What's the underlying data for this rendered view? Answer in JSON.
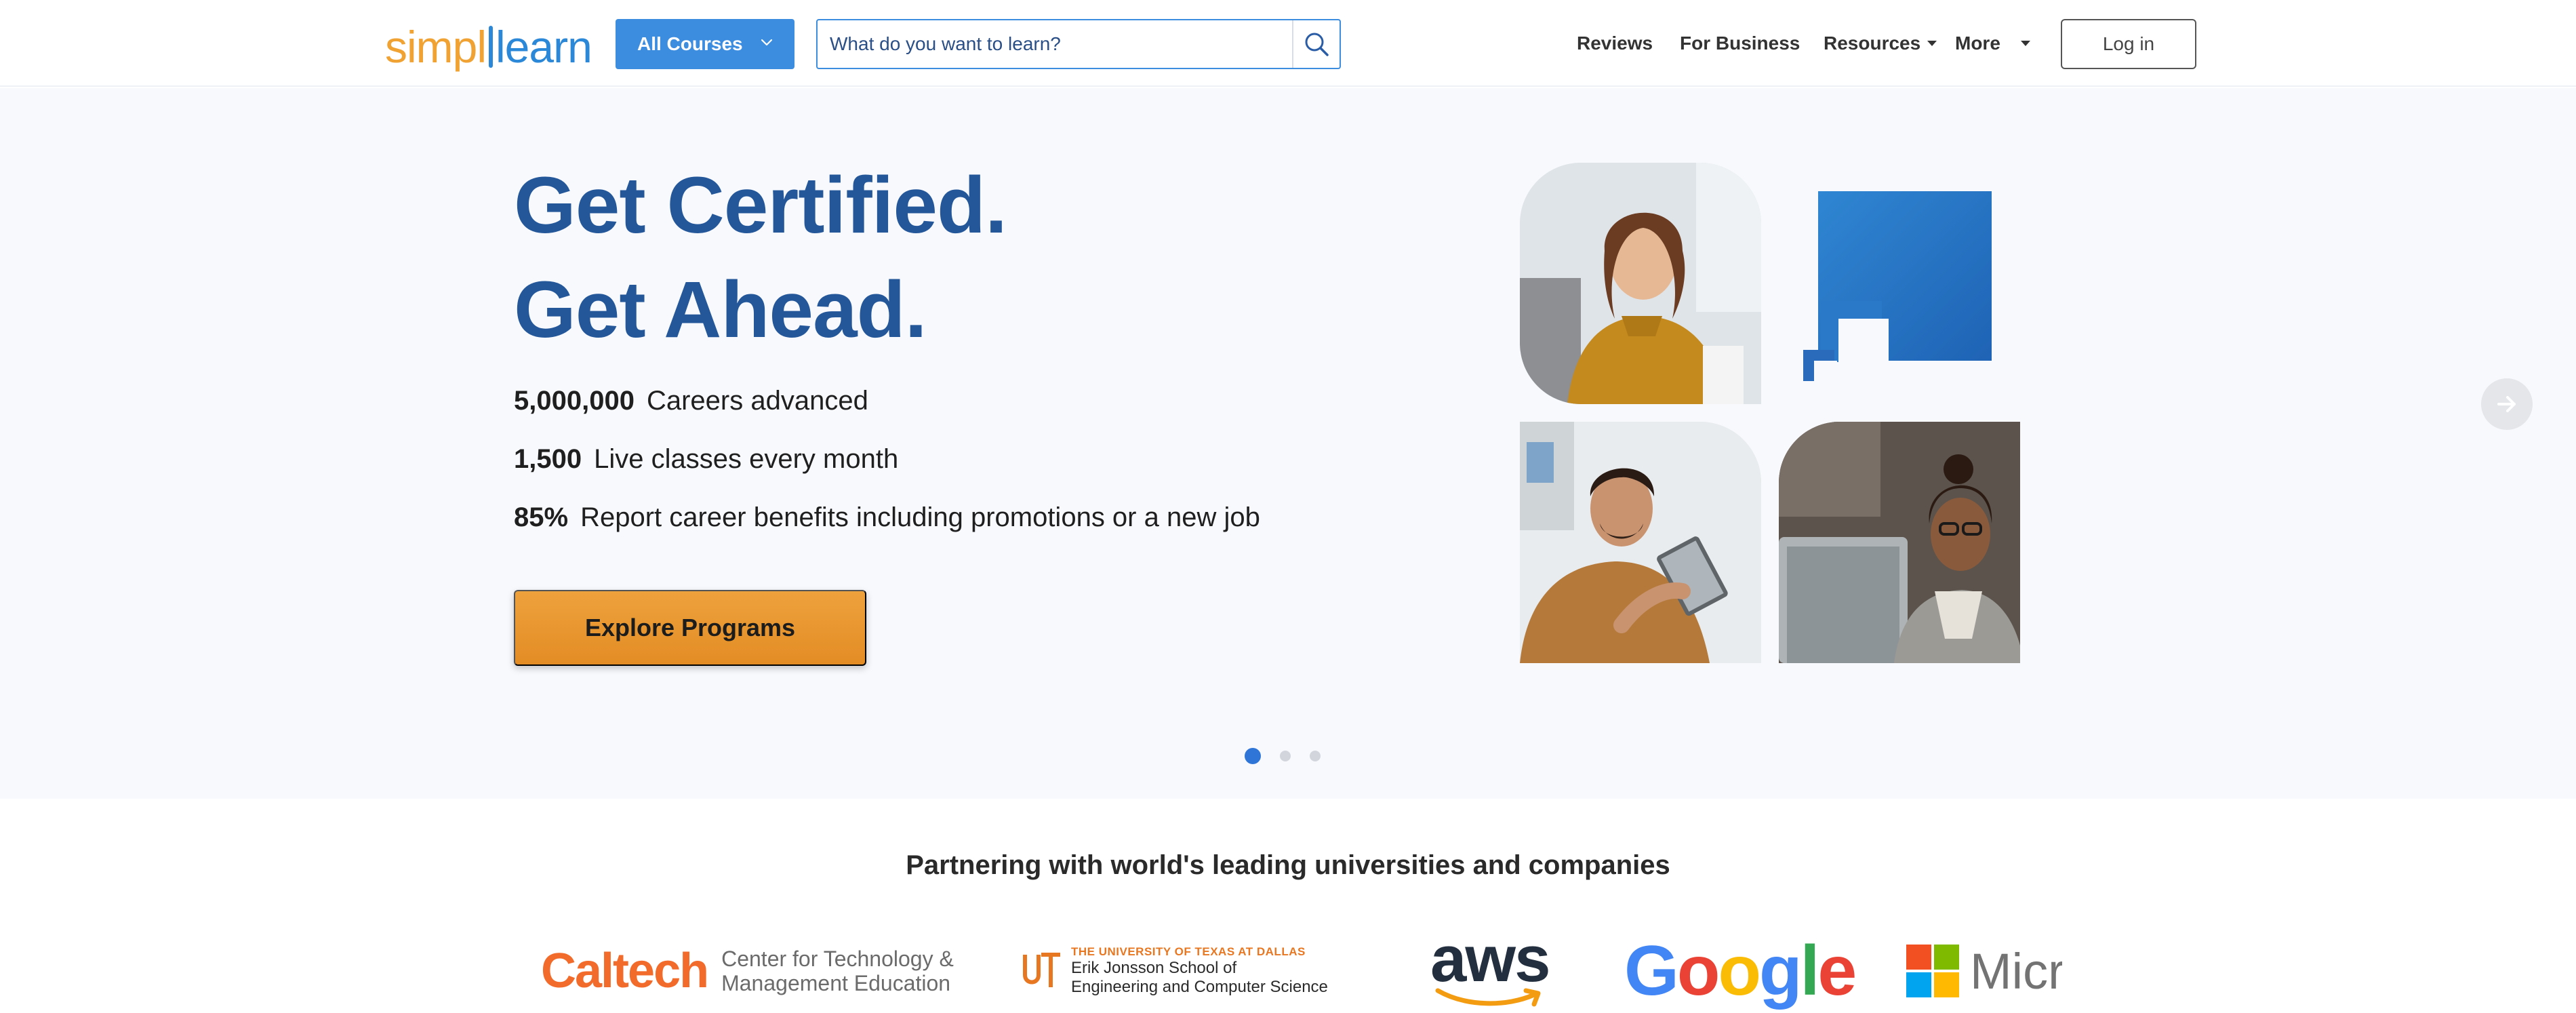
{
  "header": {
    "logo": {
      "part1": "simpl",
      "part2": "learn"
    },
    "all_courses_label": "All Courses",
    "search_placeholder": "What do you want to learn?",
    "nav": {
      "reviews": "Reviews",
      "for_business": "For Business",
      "resources": "Resources",
      "more": "More"
    },
    "login_label": "Log in"
  },
  "hero": {
    "title_line1": "Get Certified.",
    "title_line2": "Get Ahead.",
    "stats": [
      {
        "value": "5,000,000",
        "label": "Careers advanced"
      },
      {
        "value": "1,500",
        "label": "Live classes every month"
      },
      {
        "value": "85%",
        "label": "Report career benefits including promotions or a new job"
      }
    ],
    "cta_label": "Explore Programs",
    "carousel": {
      "slides": 3,
      "active_index": 0
    }
  },
  "partners": {
    "title": "Partnering with world's leading universities and companies",
    "caltech": {
      "name": "Caltech",
      "sub1": "Center for Technology &",
      "sub2": "Management Education"
    },
    "utd": {
      "line1": "THE UNIVERSITY OF TEXAS AT DALLAS",
      "line2": "Erik Jonsson School of",
      "line3": "Engineering and Computer Science"
    },
    "aws": "aws",
    "google": "Google",
    "microsoft": "Microsoft"
  },
  "colors": {
    "brand_blue": "#3c8ce0",
    "title_blue": "#24579a",
    "cta_orange": "#e9962f",
    "logo_orange": "#f0a233"
  },
  "icons": {
    "search": "search-icon",
    "chevron": "chevron-down-icon",
    "next": "arrow-right-icon"
  }
}
